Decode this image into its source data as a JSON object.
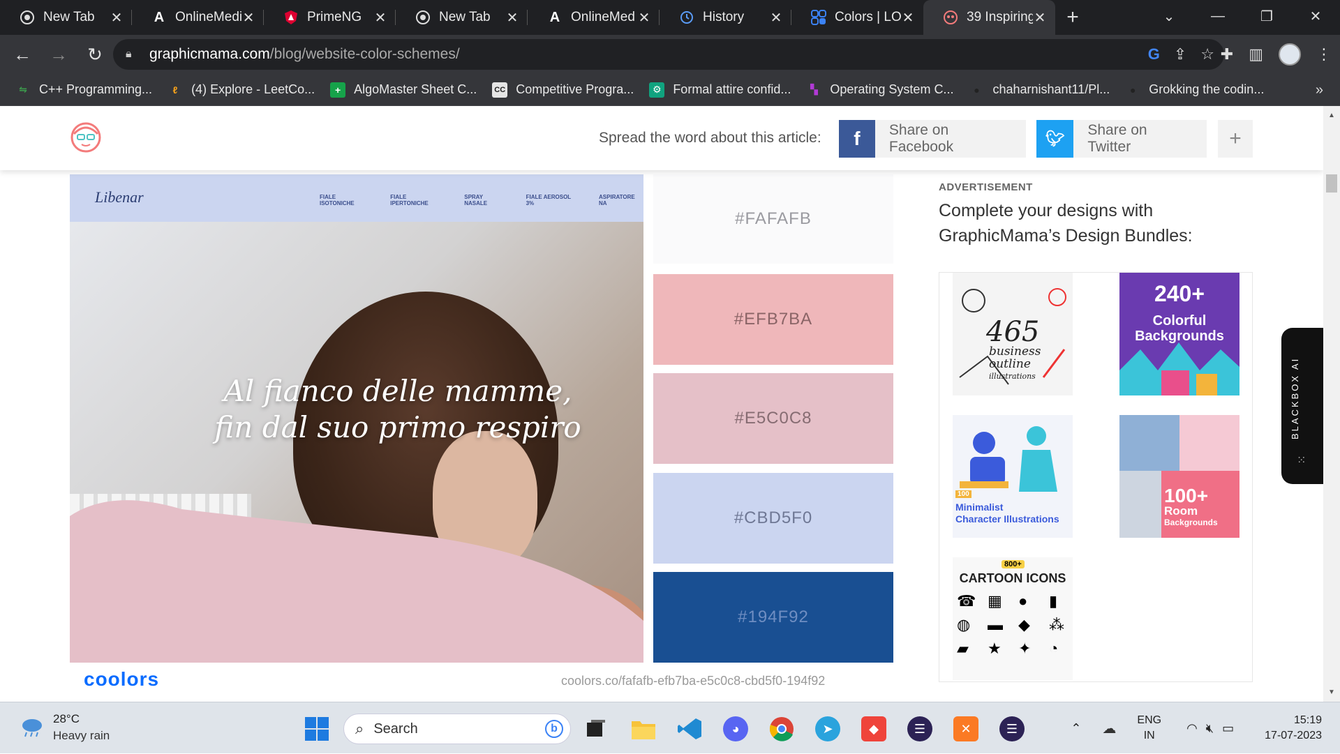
{
  "browser": {
    "tabs": [
      {
        "title": "New Tab",
        "icon": "chrome-icon"
      },
      {
        "title": "OnlineMedi",
        "icon": "a-logo-icon"
      },
      {
        "title": "PrimeNG",
        "icon": "shield-icon"
      },
      {
        "title": "New Tab",
        "icon": "chrome-icon"
      },
      {
        "title": "OnlineMed",
        "icon": "a-logo-icon"
      },
      {
        "title": "History",
        "icon": "history-icon"
      },
      {
        "title": "Colors | LO",
        "icon": "loco-icon"
      },
      {
        "title": "39 Inspiring",
        "icon": "graphicmama-icon",
        "active": true
      }
    ],
    "url_domain": "graphicmama.com",
    "url_path": "/blog/website-color-schemes/",
    "bookmarks": [
      {
        "label": "C++ Programming...",
        "color": "#3c9a4c",
        "glyph": "⇋"
      },
      {
        "label": "(4) Explore - LeetCo...",
        "color": "#f7a21b",
        "glyph": "ℓ"
      },
      {
        "label": "AlgoMaster Sheet C...",
        "color": "#16a34a",
        "glyph": "+"
      },
      {
        "label": "Competitive Progra...",
        "color": "#e5e5e5",
        "glyph": "CC"
      },
      {
        "label": "Formal attire confid...",
        "color": "#10a37f",
        "glyph": "⚙"
      },
      {
        "label": "Operating System C...",
        "color": "#b23ad6",
        "glyph": "▚"
      },
      {
        "label": "chaharnishant11/Pl...",
        "color": "#222222",
        "glyph": "●"
      },
      {
        "label": "Grokking the codin...",
        "color": "#222222",
        "glyph": "●"
      }
    ],
    "bookmarks_more": "»"
  },
  "page": {
    "spread_text": "Spread the word about this article:",
    "share_facebook": "Share on Facebook",
    "share_twitter": "Share on Twitter",
    "share_more": "+",
    "hero": {
      "brand": "Libenar",
      "menu": [
        "FIALE ISOTONICHE",
        "FIALE IPERTONICHE",
        "SPRAY NASALE",
        "FIALE AEROSOL 3%",
        "ASPIRATORE NA"
      ],
      "tagline_line1": "Al fianco delle mamme,",
      "tagline_line2": "fin dal suo primo respiro"
    },
    "palette": [
      {
        "hex": "#FAFAFB",
        "bg": "#fafafb",
        "fg": "#9a9aa0"
      },
      {
        "hex": "#EFB7BA",
        "bg": "#efb7ba",
        "fg": "#8a6466"
      },
      {
        "hex": "#E5C0C8",
        "bg": "#e5c0c8",
        "fg": "#866c72"
      },
      {
        "hex": "#CBD5F0",
        "bg": "#cbd5f0",
        "fg": "#6f7895"
      },
      {
        "hex": "#194F92",
        "bg": "#194f92",
        "fg": "#6f8ec2"
      }
    ],
    "coolors_logo": "coolors",
    "coolors_url": "coolors.co/fafafb-efb7ba-e5c0c8-cbd5f0-194f92",
    "ad": {
      "label": "ADVERTISEMENT",
      "title": "Complete your designs with GraphicMama’s Design Bundles:",
      "items": [
        {
          "line1": "465",
          "line2": "business",
          "line3": "outline",
          "line4": "illustrations"
        },
        {
          "line1": "240+",
          "line2": "Colorful",
          "line3": "Backgrounds"
        },
        {
          "line1": "100",
          "line2": "Minimalist",
          "line3": "Character Illustrations"
        },
        {
          "line1": "100+",
          "line2": "Room",
          "line3": "Backgrounds"
        },
        {
          "line1": "800+",
          "line2": "CARTOON ICONS"
        }
      ]
    },
    "blackbox_label": "BLACKBOX AI"
  },
  "taskbar": {
    "temperature": "28°C",
    "weather": "Heavy rain",
    "search_placeholder": "Search",
    "lang1": "ENG",
    "lang2": "IN",
    "time": "15:19",
    "date": "17-07-2023"
  }
}
